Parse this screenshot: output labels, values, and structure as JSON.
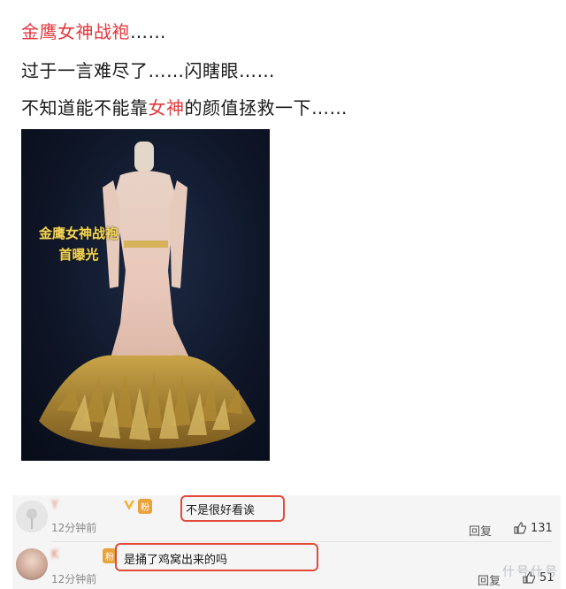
{
  "post": {
    "line1_red": "金鹰女神战袍",
    "line1_rest": "……",
    "line2": "过于一言难尽了……闪瞎眼……",
    "line3_before": "不知道能不能靠",
    "line3_red": "女神",
    "line3_after": "的颜值拯救一下……"
  },
  "image": {
    "caption_line1": "金鹰女神战袍",
    "caption_line2": "首曝光"
  },
  "comments": [
    {
      "name": "Y",
      "badge": "粉",
      "text": "不是很好看诶",
      "time": "12分钟前",
      "reply_label": "回复",
      "likes": "131"
    },
    {
      "name": "K",
      "badge": "粉",
      "text": "是捅了鸡窝出来的吗",
      "time": "12分钟前",
      "reply_label": "回复",
      "likes": "51"
    }
  ],
  "watermark": "什号什号",
  "colors": {
    "highlight_red": "#e0393e",
    "annotation_box": "#e24a3b"
  }
}
